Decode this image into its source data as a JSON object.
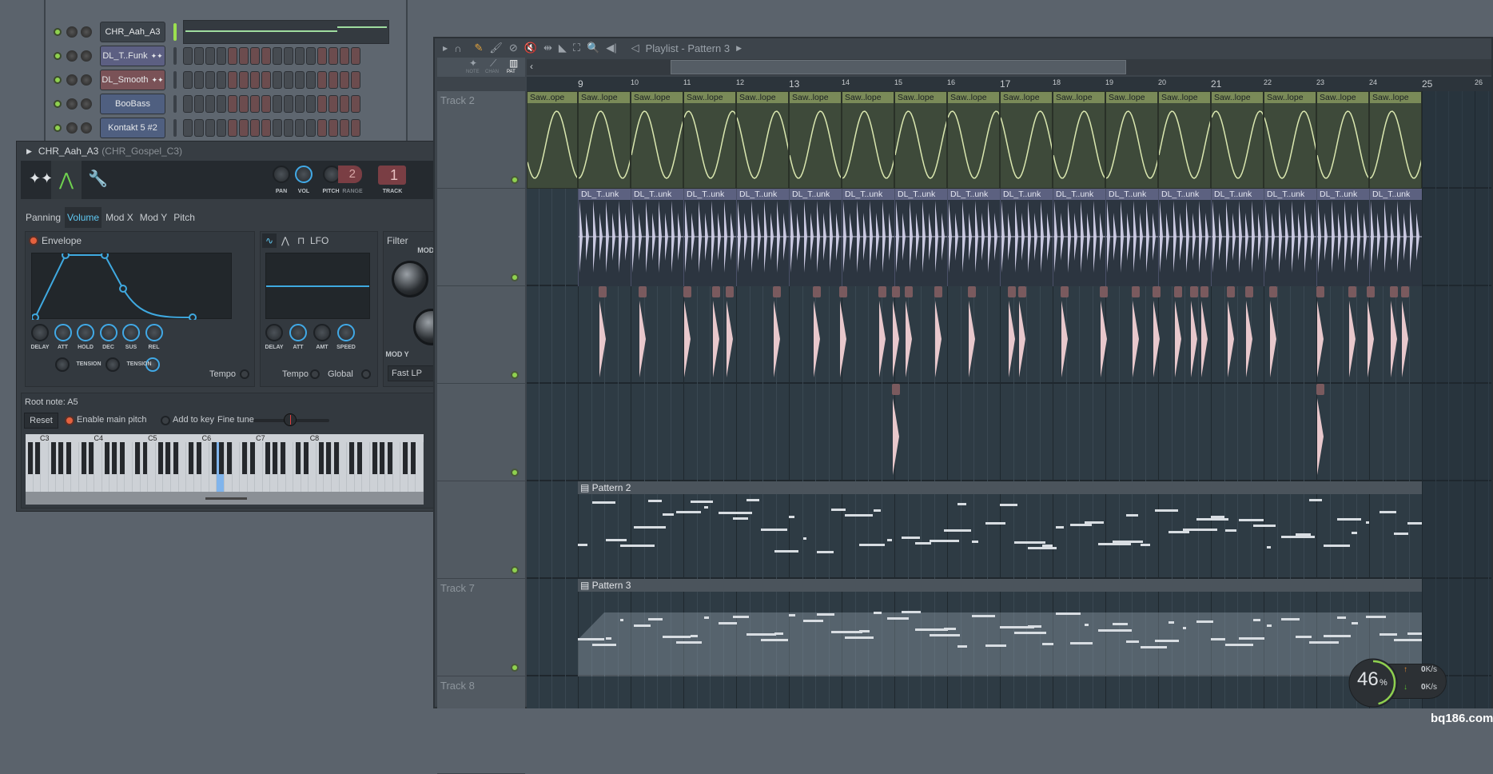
{
  "channel_rack": {
    "channels": [
      {
        "name": "CHR_Aah_A3",
        "color": "#3c434a"
      },
      {
        "name": "DL_T..Funk",
        "color": "#5c5f82",
        "wave": "✦"
      },
      {
        "name": "DL_Smooth",
        "color": "#7a5257",
        "wave": "✦"
      },
      {
        "name": "BooBass",
        "color": "#4f5f80"
      },
      {
        "name": "Kontakt 5 #2",
        "color": "#4f5f80"
      }
    ]
  },
  "instrument": {
    "title": "CHR_Aah_A3",
    "sample": "(CHR_Gospel_C3)",
    "header_knobs": {
      "pan": "PAN",
      "vol": "VOL",
      "pitch": "PITCH",
      "range": "RANGE",
      "range_value": "2",
      "track": "TRACK",
      "track_value": "1"
    },
    "tabs": [
      "Panning",
      "Volume",
      "Mod X",
      "Mod Y",
      "Pitch"
    ],
    "active_tab": "Volume",
    "envelope": {
      "label": "Envelope",
      "knobs": [
        "DELAY",
        "ATT",
        "HOLD",
        "DEC",
        "SUS",
        "REL"
      ],
      "tension": "TENSION",
      "tempo": "Tempo"
    },
    "lfo": {
      "label": "LFO",
      "knobs": [
        "DELAY",
        "ATT",
        "AMT",
        "SPEED"
      ],
      "tempo": "Tempo",
      "global": "Global"
    },
    "filter": {
      "label": "Filter",
      "mod_x": "MOD X",
      "mod_y": "MOD Y",
      "type": "Fast LP"
    },
    "root": {
      "label": "Root note: A5",
      "reset": "Reset",
      "enable_main_pitch": "Enable main pitch",
      "add_to_key": "Add to key",
      "fine_tune": "Fine tune"
    },
    "octaves": [
      "C3",
      "C4",
      "C5",
      "C6",
      "C7",
      "C8"
    ]
  },
  "playlist": {
    "title": "Playlist - Pattern 3",
    "modes": {
      "note": "NOTE",
      "chan": "CHAN",
      "pat": "PAT"
    },
    "bars": [
      "9",
      "10",
      "11",
      "12",
      "13",
      "14",
      "15",
      "16",
      "17",
      "18",
      "19",
      "20",
      "21",
      "22",
      "23",
      "24",
      "25",
      "26"
    ],
    "tracks": [
      {
        "name": "Track 2"
      },
      {
        "name": ""
      },
      {
        "name": ""
      },
      {
        "name": ""
      },
      {
        "name": ""
      },
      {
        "name": "Track 7"
      },
      {
        "name": "Track 8"
      }
    ],
    "clips": {
      "saw": "Saw..lope",
      "saw_first": "Saw..ope",
      "funk": "DL_T..unk",
      "pattern2": "Pattern 2",
      "pattern3": "Pattern 3"
    },
    "colors": {
      "saw": "#7a8a58",
      "funk": "#5c6180",
      "smooth": "#7a5a5e",
      "pattern": "#4b545c"
    }
  },
  "cpu_meter": {
    "percent": "46",
    "unit": "%",
    "up": "0",
    "down": "0",
    "rate_unit": "K/s",
    "progress": 0.46
  },
  "watermark": "bq186.com"
}
